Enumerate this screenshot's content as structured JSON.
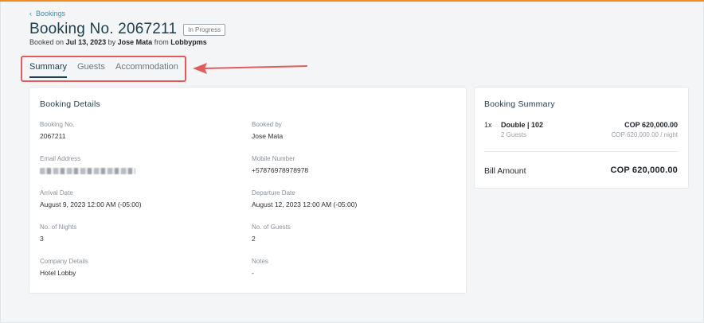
{
  "breadcrumb": {
    "label": "Bookings"
  },
  "header": {
    "title": "Booking No. 2067211",
    "status": "In Progress",
    "booked_prefix": "Booked on",
    "booked_date": "Jul 13, 2023",
    "by_word": "by",
    "booked_by": "Jose Mata",
    "from_word": "from",
    "source": "Lobbypms"
  },
  "tabs": [
    {
      "label": "Summary",
      "active": true
    },
    {
      "label": "Guests",
      "active": false
    },
    {
      "label": "Accommodation",
      "active": false
    }
  ],
  "details": {
    "title": "Booking Details",
    "fields": {
      "booking_no": {
        "label": "Booking No.",
        "value": "2067211"
      },
      "booked_by": {
        "label": "Booked by",
        "value": "Jose Mata"
      },
      "email": {
        "label": "Email Address"
      },
      "mobile": {
        "label": "Mobile Number",
        "value": "+57876978978978"
      },
      "arrival": {
        "label": "Arrival Date",
        "value": "August 9, 2023 12:00 AM (-05:00)"
      },
      "departure": {
        "label": "Departure Date",
        "value": "August 12, 2023 12:00 AM (-05:00)"
      },
      "nights": {
        "label": "No. of Nights",
        "value": "3"
      },
      "guests": {
        "label": "No. of Guests",
        "value": "2"
      },
      "company": {
        "label": "Company Details",
        "value": "Hotel Lobby"
      },
      "notes": {
        "label": "Notes",
        "value": "-"
      }
    }
  },
  "summary": {
    "title": "Booking Summary",
    "item": {
      "qty": "1x",
      "room": "Double | 102",
      "price": "COP 620,000.00",
      "guests": "2 Guests",
      "per_night": "COP 620,000.00 / night"
    },
    "bill_label": "Bill Amount",
    "bill_value": "COP 620,000.00"
  },
  "colors": {
    "accent_top": "#f08a24",
    "brand": "#1f3e4d",
    "link": "#3f8fb0",
    "annotation": "#e45b5b"
  },
  "icons": [
    "chevron-left-icon",
    "annotation-arrow-icon"
  ]
}
